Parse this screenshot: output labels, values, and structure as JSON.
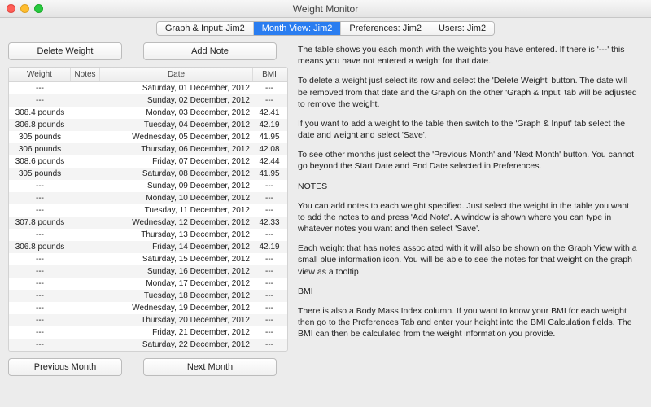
{
  "window": {
    "title": "Weight Monitor"
  },
  "tabs": [
    {
      "label": "Graph & Input: Jim2",
      "active": false
    },
    {
      "label": "Month View: Jim2",
      "active": true
    },
    {
      "label": "Preferences: Jim2",
      "active": false
    },
    {
      "label": "Users: Jim2",
      "active": false
    }
  ],
  "buttons": {
    "delete": "Delete Weight",
    "addnote": "Add Note",
    "prev": "Previous Month",
    "next": "Next Month"
  },
  "table": {
    "headers": {
      "weight": "Weight",
      "notes": "Notes",
      "date": "Date",
      "bmi": "BMI"
    },
    "rows": [
      {
        "weight": "---",
        "notes": "",
        "date": "Saturday, 01 December, 2012",
        "bmi": "---"
      },
      {
        "weight": "---",
        "notes": "",
        "date": "Sunday, 02 December, 2012",
        "bmi": "---"
      },
      {
        "weight": "308.4 pounds",
        "notes": "",
        "date": "Monday, 03 December, 2012",
        "bmi": "42.41"
      },
      {
        "weight": "306.8 pounds",
        "notes": "",
        "date": "Tuesday, 04 December, 2012",
        "bmi": "42.19"
      },
      {
        "weight": "305 pounds",
        "notes": "",
        "date": "Wednesday, 05 December, 2012",
        "bmi": "41.95"
      },
      {
        "weight": "306 pounds",
        "notes": "",
        "date": "Thursday, 06 December, 2012",
        "bmi": "42.08"
      },
      {
        "weight": "308.6 pounds",
        "notes": "",
        "date": "Friday, 07 December, 2012",
        "bmi": "42.44"
      },
      {
        "weight": "305 pounds",
        "notes": "",
        "date": "Saturday, 08 December, 2012",
        "bmi": "41.95"
      },
      {
        "weight": "---",
        "notes": "",
        "date": "Sunday, 09 December, 2012",
        "bmi": "---"
      },
      {
        "weight": "---",
        "notes": "",
        "date": "Monday, 10 December, 2012",
        "bmi": "---"
      },
      {
        "weight": "---",
        "notes": "",
        "date": "Tuesday, 11 December, 2012",
        "bmi": "---"
      },
      {
        "weight": "307.8 pounds",
        "notes": "",
        "date": "Wednesday, 12 December, 2012",
        "bmi": "42.33"
      },
      {
        "weight": "---",
        "notes": "",
        "date": "Thursday, 13 December, 2012",
        "bmi": "---"
      },
      {
        "weight": "306.8 pounds",
        "notes": "",
        "date": "Friday, 14 December, 2012",
        "bmi": "42.19"
      },
      {
        "weight": "---",
        "notes": "",
        "date": "Saturday, 15 December, 2012",
        "bmi": "---"
      },
      {
        "weight": "---",
        "notes": "",
        "date": "Sunday, 16 December, 2012",
        "bmi": "---"
      },
      {
        "weight": "---",
        "notes": "",
        "date": "Monday, 17 December, 2012",
        "bmi": "---"
      },
      {
        "weight": "---",
        "notes": "",
        "date": "Tuesday, 18 December, 2012",
        "bmi": "---"
      },
      {
        "weight": "---",
        "notes": "",
        "date": "Wednesday, 19 December, 2012",
        "bmi": "---"
      },
      {
        "weight": "---",
        "notes": "",
        "date": "Thursday, 20 December, 2012",
        "bmi": "---"
      },
      {
        "weight": "---",
        "notes": "",
        "date": "Friday, 21 December, 2012",
        "bmi": "---"
      },
      {
        "weight": "---",
        "notes": "",
        "date": "Saturday, 22 December, 2012",
        "bmi": "---"
      }
    ]
  },
  "help": {
    "p1": "The table shows you each month with the weights you have entered. If there is '---' this means you have not entered a weight for that date.",
    "p2": "To delete a weight just select its row and select the 'Delete Weight' button.  The date will be removed from that date and the Graph on the other 'Graph & Input' tab will be adjusted to remove the weight.",
    "p3": "If you want to add a weight to the table then switch to the 'Graph & Input' tab select the date and weight and select 'Save'.",
    "p4": "To see other months just select the 'Previous Month' and 'Next Month' button.  You cannot go beyond the Start Date and End Date selected in Preferences.",
    "h1": "NOTES",
    "p5": "You can add notes to each weight specified.  Just select the weight in the table you want to add the notes to and press 'Add Note'.  A window is shown where you can type in whatever notes you want and then select 'Save'.",
    "p6": "Each weight that has notes associated with it will also be shown on the Graph View with a small blue information icon.  You will be able to see the notes for that weight on the graph view as a tooltip",
    "h2": "BMI",
    "p7": "There is also a Body Mass Index column.  If you want to know your BMI for each weight then go to the Preferences Tab and enter your height into the BMI Calculation fields.  The BMI can then be calculated from the weight information you provide."
  }
}
